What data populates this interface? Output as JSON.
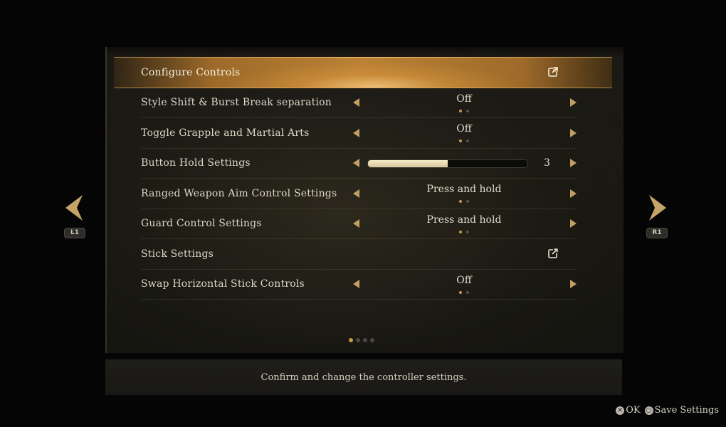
{
  "menu": {
    "rows": [
      {
        "label": "Configure Controls",
        "type": "link",
        "icon": "external-link-icon"
      },
      {
        "label": "Style Shift & Burst Break separation",
        "type": "toggle",
        "value": "Off",
        "option_index": 0,
        "option_count": 2
      },
      {
        "label": "Toggle Grapple and Martial Arts",
        "type": "toggle",
        "value": "Off",
        "option_index": 0,
        "option_count": 2
      },
      {
        "label": "Button Hold Settings",
        "type": "slider",
        "value": "3",
        "level": 0.5
      },
      {
        "label": "Ranged Weapon Aim Control Settings",
        "type": "toggle",
        "value": "Press and hold",
        "option_index": 0,
        "option_count": 2
      },
      {
        "label": "Guard Control Settings",
        "type": "toggle",
        "value": "Press and hold",
        "option_index": 0,
        "option_count": 2
      },
      {
        "label": "Stick Settings",
        "type": "link",
        "icon": "external-link-icon"
      },
      {
        "label": "Swap Horizontal Stick Controls",
        "type": "toggle",
        "value": "Off",
        "option_index": 0,
        "option_count": 2
      }
    ],
    "selected_index": 0
  },
  "pager": {
    "current": 0,
    "count": 4
  },
  "nav": {
    "left_button": "L1",
    "right_button": "R1"
  },
  "description": "Confirm and change the controller settings.",
  "footer": {
    "ok_label": "OK",
    "save_label": "Save Settings",
    "ok_icon": "cross-button-icon",
    "save_icon": "circle-button-icon"
  },
  "colors": {
    "accent": "#c2a063",
    "highlight": "#c08a3a",
    "background": "#050505"
  }
}
